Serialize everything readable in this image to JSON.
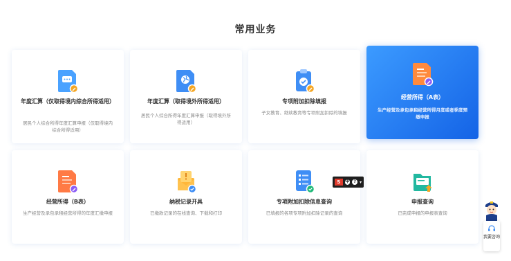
{
  "section": {
    "title": "常用业务"
  },
  "cards": [
    {
      "title": "年度汇算（仅取得境内综合所得适用）",
      "desc": "居民个人综合所得年度汇算申报（仅取得境内综合所得适用）",
      "icon": "doc-chat-icon",
      "active": false
    },
    {
      "title": "年度汇算（取得境外所得适用）",
      "desc": "居民个人综合所得年度汇算申报（取得境外所得适用）",
      "icon": "globe-doc-icon",
      "active": false
    },
    {
      "title": "专项附加扣除填报",
      "desc": "子女教育、继续教育等专项附加扣除的填报",
      "icon": "clipboard-check-icon",
      "active": false
    },
    {
      "title": "经营所得（A表）",
      "desc": "生产经营及承包承租经营所得月度或者季度预缴申报",
      "icon": "document-a-icon",
      "active": true
    },
    {
      "title": "经营所得（B表）",
      "desc": "生产经营及承包承租经营所得的年度汇缴申报",
      "icon": "document-b-icon",
      "active": false
    },
    {
      "title": "纳税记录开具",
      "desc": "已缴款记录的在线查询、下载和打印",
      "icon": "envelope-alert-icon",
      "active": false
    },
    {
      "title": "专项附加扣除信息查询",
      "desc": "已填报的各项专项附加扣除记录的查询",
      "icon": "list-query-icon",
      "active": false
    },
    {
      "title": "申报查询",
      "desc": "已完成申报的申报表查询",
      "icon": "folder-upload-icon",
      "active": false
    }
  ],
  "toolbar": {
    "logo": "S",
    "btn1": "中",
    "btn2": "?"
  },
  "assistant": {
    "label": "我要咨询"
  },
  "colors": {
    "accent": "#1e78f0",
    "active_card": "#1463e6",
    "badge_orange": "#f5a623",
    "badge_purple": "#8b5cf6"
  }
}
